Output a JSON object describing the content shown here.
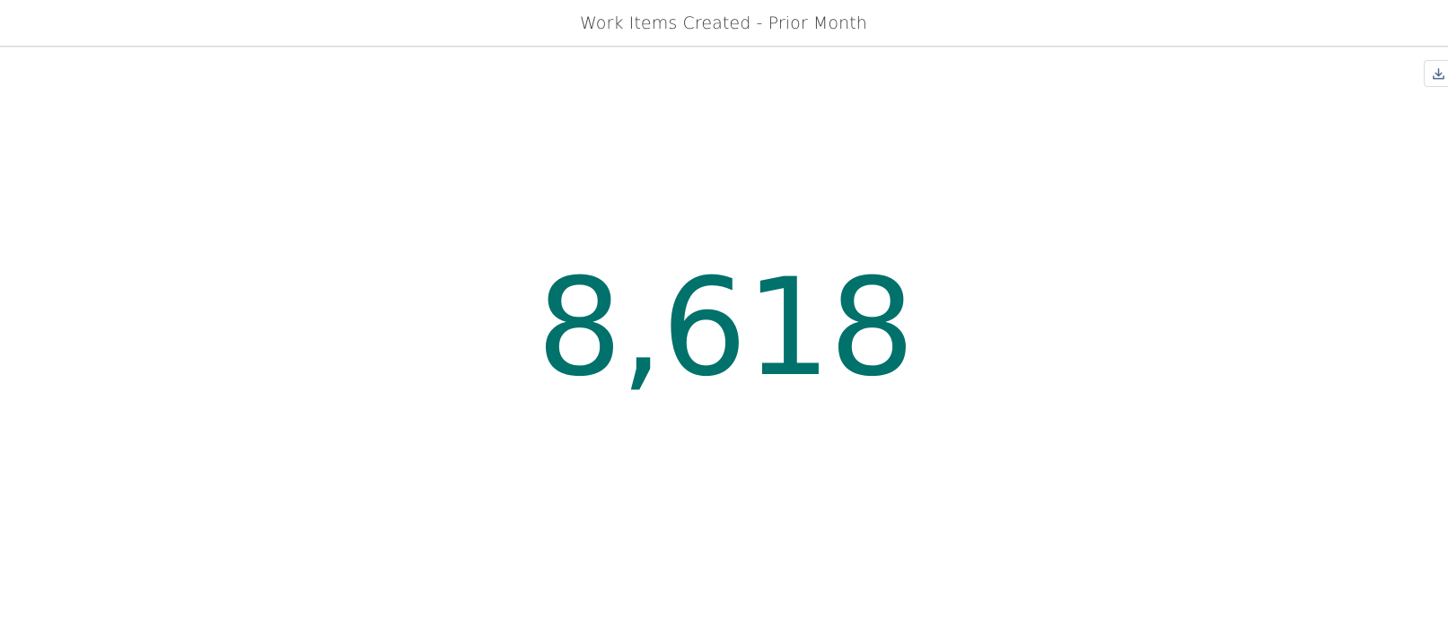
{
  "header": {
    "title": "Work Items Created - Prior Month"
  },
  "toolbar": {
    "download_icon": "download-icon"
  },
  "metric": {
    "value": "8,618",
    "color": "#00716b"
  }
}
